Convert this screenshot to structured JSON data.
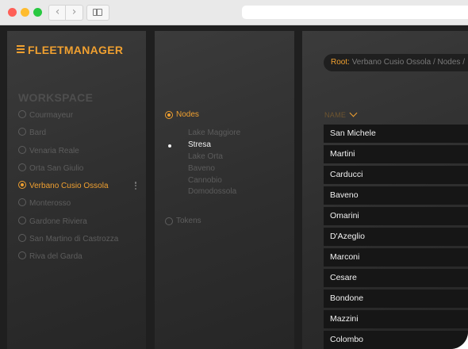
{
  "app": {
    "logo": "FLEETMANAGER"
  },
  "browser": {
    "back_glyph": "‹",
    "forward_glyph": "›"
  },
  "workspace": {
    "title": "WORKSPACE",
    "items": [
      {
        "label": "Courmayeur",
        "active": false
      },
      {
        "label": "Bard",
        "active": false
      },
      {
        "label": "Venaria Reale",
        "active": false
      },
      {
        "label": "Orta San Giulio",
        "active": false
      },
      {
        "label": "Verbano Cusio Ossola",
        "active": true
      },
      {
        "label": "Monterosso",
        "active": false
      },
      {
        "label": "Gardone Riviera",
        "active": false
      },
      {
        "label": "San Martino di Castrozza",
        "active": false
      },
      {
        "label": "Riva del Garda",
        "active": false
      }
    ]
  },
  "tree": {
    "nodes_label": "Nodes",
    "tokens_label": "Tokens",
    "nodes": [
      {
        "label": "Lake Maggiore",
        "selected": false
      },
      {
        "label": "Stresa",
        "selected": true
      },
      {
        "label": "Lake Orta",
        "selected": false
      },
      {
        "label": "Baveno",
        "selected": false
      },
      {
        "label": "Cannobio",
        "selected": false
      },
      {
        "label": "Domodossola",
        "selected": false
      }
    ]
  },
  "content": {
    "breadcrumb_root": "Root:",
    "breadcrumb_path": "Verbano Cusio Ossola / Nodes /",
    "column_header": "NAME",
    "rows": [
      "San Michele",
      "Martini",
      "Carducci",
      "Baveno",
      "Omarini",
      "D'Azeglio",
      "Marconi",
      "Cesare",
      "Bondone",
      "Mazzini",
      "Colombo"
    ]
  },
  "colors": {
    "accent": "#f0a030",
    "background": "#1f1f1f",
    "panel": "#333333"
  }
}
